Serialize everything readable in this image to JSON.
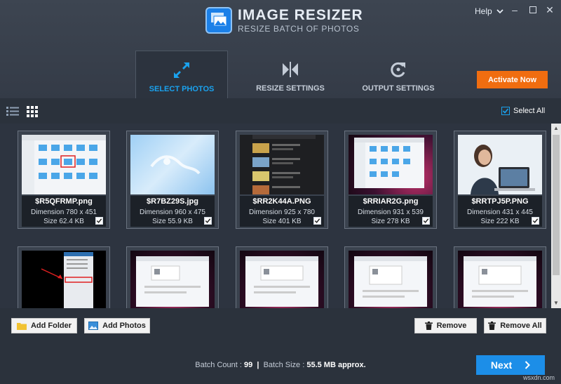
{
  "app": {
    "title": "IMAGE RESIZER",
    "subtitle": "RESIZE BATCH OF PHOTOS",
    "help_label": "Help"
  },
  "tabs": [
    {
      "label": "SELECT PHOTOS",
      "icon": "expand-arrows-icon",
      "active": true
    },
    {
      "label": "RESIZE SETTINGS",
      "icon": "resize-arrows-icon",
      "active": false
    },
    {
      "label": "OUTPUT SETTINGS",
      "icon": "refresh-settings-icon",
      "active": false
    }
  ],
  "activate_label": "Activate Now",
  "toolbar": {
    "select_all_label": "Select All",
    "select_all_checked": true
  },
  "photos": [
    {
      "filename": "$R5QFRMP.png",
      "dimension": "Dimension 780 x 451",
      "size": "Size 62.4 KB",
      "checked": true
    },
    {
      "filename": "$R7BZ29S.jpg",
      "dimension": "Dimension 960 x 475",
      "size": "Size 55.9 KB",
      "checked": true
    },
    {
      "filename": "$RR2K44A.PNG",
      "dimension": "Dimension 925 x 780",
      "size": "Size 401 KB",
      "checked": true
    },
    {
      "filename": "$RRIAR2G.png",
      "dimension": "Dimension 931 x 539",
      "size": "Size 278 KB",
      "checked": true
    },
    {
      "filename": "$RRTPJ5P.PNG",
      "dimension": "Dimension 431 x 445",
      "size": "Size 222 KB",
      "checked": true
    }
  ],
  "buttons": {
    "add_folder": "Add Folder",
    "add_photos": "Add Photos",
    "remove": "Remove",
    "remove_all": "Remove All",
    "next": "Next"
  },
  "status": {
    "batch_count_label": "Batch Count :",
    "batch_count": "99",
    "separator": "|",
    "batch_size_label": "Batch Size :",
    "batch_size": "55.5 MB approx."
  },
  "watermark": "wsxdn.com",
  "colors": {
    "accent_blue": "#1aa2ee",
    "activate_orange": "#f06d10",
    "next_blue": "#1c8ee8",
    "background": "#2d3440"
  }
}
